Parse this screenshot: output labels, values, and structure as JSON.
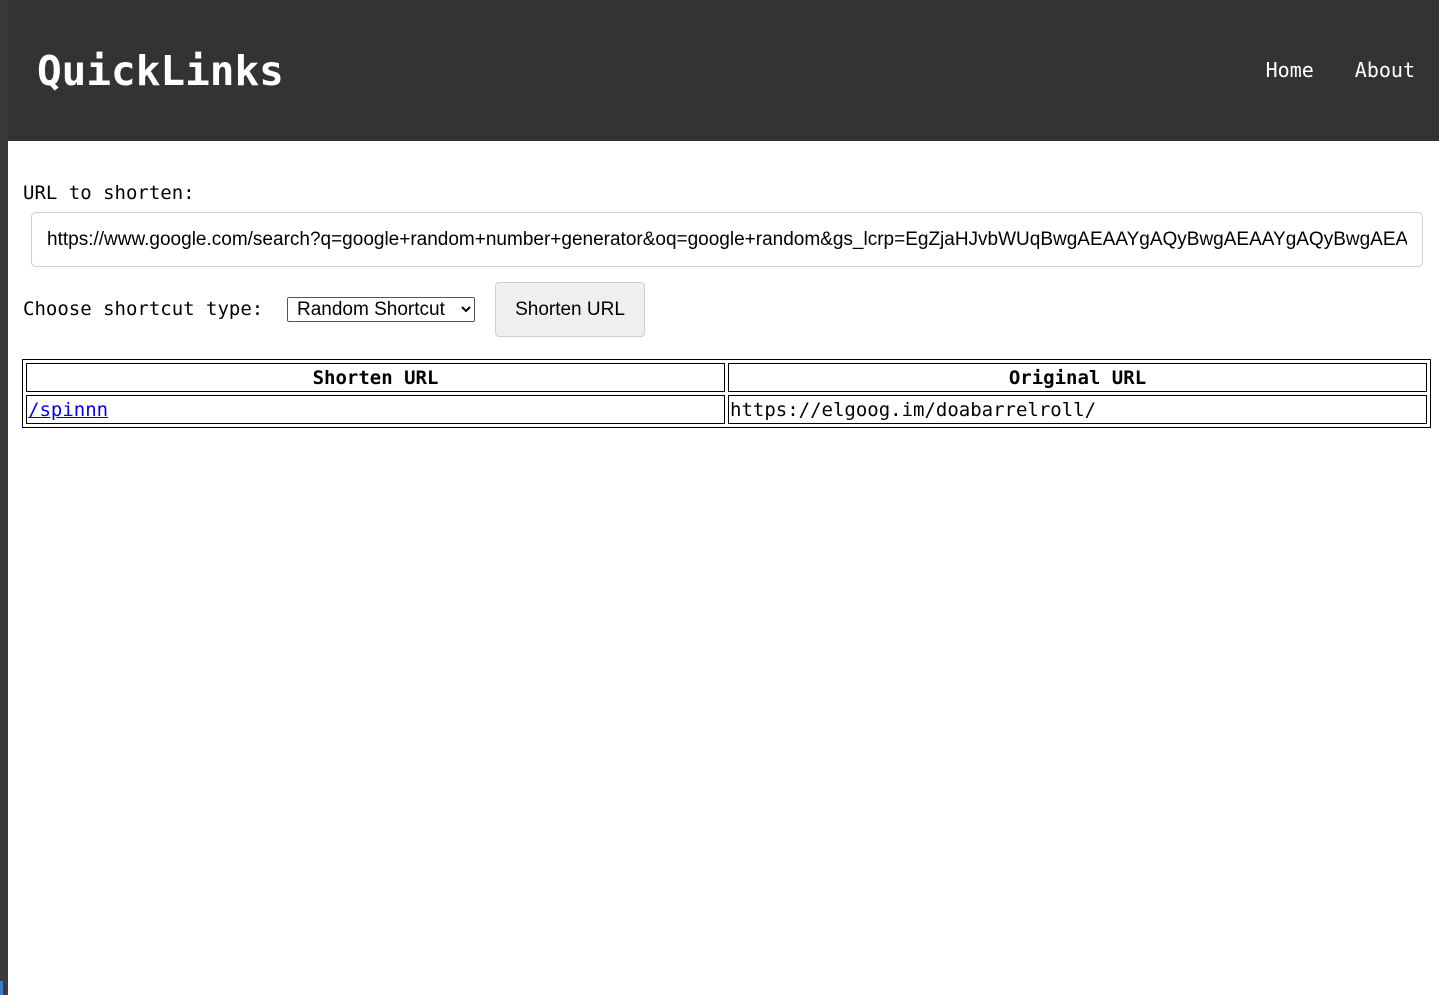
{
  "header": {
    "brand": "QuickLinks",
    "nav": [
      {
        "label": "Home"
      },
      {
        "label": "About"
      }
    ]
  },
  "form": {
    "url_label": "URL to shorten:",
    "url_value": "https://www.google.com/search?q=google+random+number+generator&oq=google+random&gs_lcrp=EgZjaHJvbWUqBwgAEAAYgAQyBwgAEAAYgAQyBwgAEAAYgAQ",
    "type_label": "Choose shortcut type:",
    "type_selected": "Random Shortcut",
    "shorten_button": "Shorten URL"
  },
  "table": {
    "headers": [
      "Shorten URL",
      "Original URL"
    ],
    "rows": [
      {
        "short": "/spinnn",
        "original": "https://elgoog.im/doabarrelroll/"
      }
    ]
  }
}
